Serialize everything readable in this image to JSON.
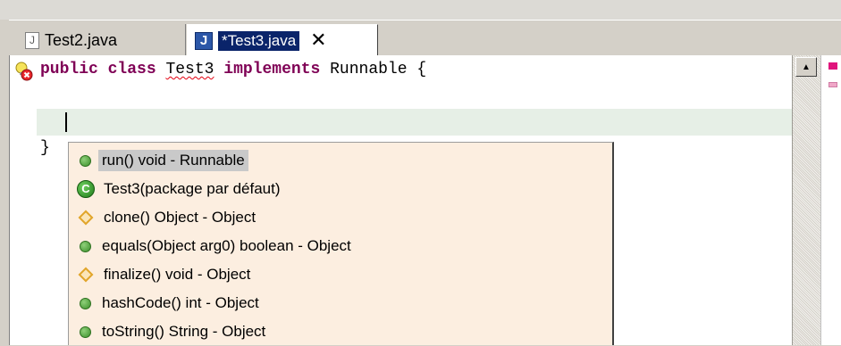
{
  "tabs": [
    {
      "label": "Test2.java",
      "icon": "java-file-icon",
      "active": false
    },
    {
      "label": "*Test3.java",
      "icon": "java-editor-icon",
      "active": true,
      "close": "✕"
    }
  ],
  "editor": {
    "line1": {
      "kw1": "public",
      "kw2": "class",
      "class_name": "Test3",
      "kw3": "implements",
      "iface": "Runnable",
      "brace": "{"
    },
    "line3": "}"
  },
  "content_assist": {
    "proposals": [
      {
        "label": "run()  void - Runnable",
        "icon": "public-method-icon",
        "selected": true
      },
      {
        "label": "Test3(package par défaut)",
        "icon": "class-icon",
        "selected": false
      },
      {
        "label": "clone()  Object - Object",
        "icon": "protected-method-icon",
        "selected": false
      },
      {
        "label": "equals(Object arg0)  boolean - Object",
        "icon": "public-method-icon",
        "selected": false
      },
      {
        "label": "finalize()  void - Object",
        "icon": "protected-method-icon",
        "selected": false
      },
      {
        "label": "hashCode()  int - Object",
        "icon": "public-method-icon",
        "selected": false
      },
      {
        "label": "toString()  String - Object",
        "icon": "public-method-icon",
        "selected": false
      }
    ],
    "class_icon_letter": "C"
  },
  "colors": {
    "keyword": "#7f0055",
    "popup_bg": "#fceee0",
    "current_line": "#e6efe6",
    "tab_selection": "#0a246a",
    "error_underline": "#e3000f"
  }
}
